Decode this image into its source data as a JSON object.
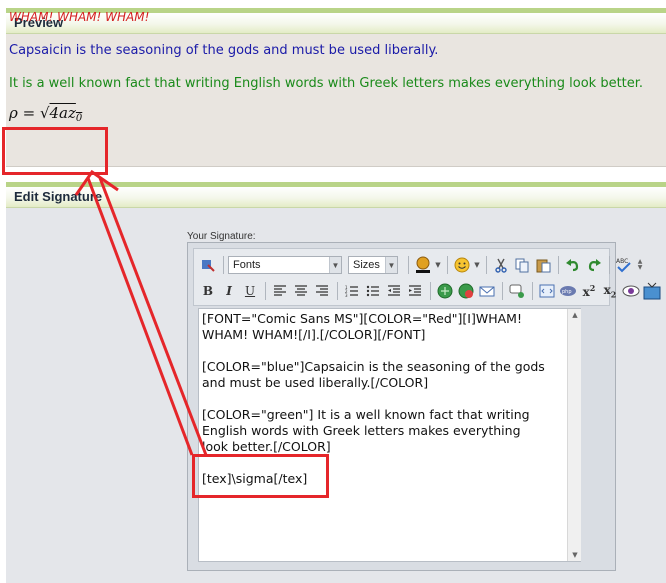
{
  "preview": {
    "header": "Preview",
    "line_red": "WHAM! WHAM! WHAM!",
    "line_blue": "Capsaicin is the seasoning of the gods and must be used liberally.",
    "line_green": "It is a well known fact that writing English words with Greek letters makes everything look better.",
    "formula": {
      "lhs": "ρ = ",
      "radical": "√",
      "radicand": "4az",
      "subscript": "0"
    }
  },
  "edit": {
    "header": "Edit Signature",
    "signature_label": "Your Signature:",
    "toolbar": {
      "fonts": "Fonts",
      "sizes": "Sizes",
      "row1_icons": [
        "remove-format-icon",
        "font-color-icon",
        "smiley-icon",
        "cut-icon",
        "copy-icon",
        "paste-icon",
        "undo-icon",
        "redo-icon",
        "spellcheck-icon"
      ],
      "row2": {
        "bold": "B",
        "italic": "I",
        "underline": "U",
        "superscript": "x2",
        "subscript": "x2"
      }
    },
    "textarea_value": "[FONT=\"Comic Sans MS\"][COLOR=\"Red\"][I]WHAM!\nWHAM! WHAM![/I].[/COLOR][/FONT]\n\n[COLOR=\"blue\"]Capsaicin is the seasoning of the gods\nand must be used liberally.[/COLOR]\n\n[COLOR=\"green\"] It is a well known fact that writing\nEnglish words with Greek letters makes everything\nlook better.[/COLOR]\n\n[tex]\\sigma[/tex]"
  },
  "colors": {
    "annotation": "#e5262a",
    "red_text": "#d42020",
    "blue_text": "#1a1aa8",
    "green_text": "#1a8a1a"
  }
}
